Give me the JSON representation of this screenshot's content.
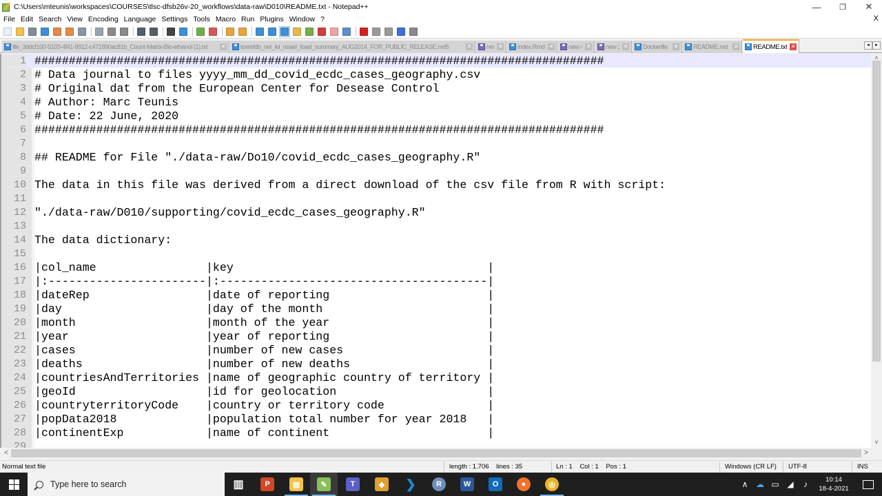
{
  "window": {
    "title": "C:\\Users\\mteunis\\workspaces\\COURSES\\tlsc-dfsb26v-20_workflows\\data-raw\\D010\\README.txt - Notepad++",
    "minimize": "—",
    "restore": "❐",
    "close": "✕"
  },
  "menu": {
    "items": [
      "File",
      "Edit",
      "Search",
      "View",
      "Encoding",
      "Language",
      "Settings",
      "Tools",
      "Macro",
      "Run",
      "Plugins",
      "Window",
      "?"
    ],
    "close_doc": "X"
  },
  "toolbar": {
    "buttons": [
      {
        "name": "new-file",
        "color": "#e9f0f8"
      },
      {
        "name": "open-file",
        "color": "#f3c24b"
      },
      {
        "name": "save",
        "color": "#7f8d9c"
      },
      {
        "name": "save-all",
        "color": "#3d8fd8"
      },
      {
        "name": "close",
        "color": "#e38a4a"
      },
      {
        "name": "close-all",
        "color": "#e38a4a"
      },
      {
        "name": "print",
        "color": "#8a96a6"
      },
      {
        "name": "sep"
      },
      {
        "name": "cut",
        "color": "#9aa3ad"
      },
      {
        "name": "copy",
        "color": "#8a8a8a"
      },
      {
        "name": "paste",
        "color": "#8a8a8a"
      },
      {
        "name": "sep"
      },
      {
        "name": "undo",
        "color": "#555f6b"
      },
      {
        "name": "redo",
        "color": "#555f6b"
      },
      {
        "name": "sep"
      },
      {
        "name": "find",
        "color": "#444"
      },
      {
        "name": "replace",
        "color": "#3d8fd8"
      },
      {
        "name": "sep"
      },
      {
        "name": "zoom-in",
        "color": "#6bb04a"
      },
      {
        "name": "zoom-out",
        "color": "#d45a5a"
      },
      {
        "name": "sep"
      },
      {
        "name": "sync-vertical",
        "color": "#e8a43a"
      },
      {
        "name": "sync-horizontal",
        "color": "#e8a43a"
      },
      {
        "name": "sep"
      },
      {
        "name": "word-wrap",
        "color": "#3d8fd8"
      },
      {
        "name": "show-all-chars",
        "color": "#3d8fd8"
      },
      {
        "name": "indent-guide",
        "color": "#3d8fd8",
        "active": true
      },
      {
        "name": "udl",
        "color": "#e8b94a"
      },
      {
        "name": "doc-map",
        "color": "#7cab4c"
      },
      {
        "name": "function-list",
        "color": "#d43d3d"
      },
      {
        "name": "folder-workspace",
        "color": "#f0a3a3"
      },
      {
        "name": "doc-monitor",
        "color": "#5a8fc8"
      },
      {
        "name": "sep"
      },
      {
        "name": "record-macro",
        "color": "#d42020"
      },
      {
        "name": "stop-recording",
        "color": "#9a9a9a"
      },
      {
        "name": "playback-macro",
        "color": "#9a9a9a"
      },
      {
        "name": "run-macro-multiple",
        "color": "#3d6fd8"
      },
      {
        "name": "save-macro",
        "color": "#8a8a8a"
      }
    ]
  },
  "tabs": [
    {
      "label": "file_3ddcf100-5103-4f41-9912-c471890ac81b_Count-Matrix-Bio-ethanol (1).txt",
      "icon": "blue",
      "active": false
    },
    {
      "label": "toxrefdb_nel_lel_noael_loael_summary_AUG2014_FOR_PUBLIC_RELEASE.md5",
      "icon": "blue",
      "active": false
    },
    {
      "label": "new 2",
      "icon": "purple",
      "active": false
    },
    {
      "label": "index.Rmd",
      "icon": "blue",
      "active": false
    },
    {
      "label": "new 4",
      "icon": "purple",
      "active": false
    },
    {
      "label": "new 3",
      "icon": "purple",
      "active": false
    },
    {
      "label": "Dockerfile",
      "icon": "blue",
      "active": false
    },
    {
      "label": "README.md",
      "icon": "blue",
      "active": false
    },
    {
      "label": "README.txt",
      "icon": "blue",
      "active": true
    }
  ],
  "tab_scroll": {
    "left": "◂",
    "right": "▸"
  },
  "editor": {
    "current_line": 1,
    "lines": [
      "###################################################################################",
      "# Data journal to files yyyy_mm_dd_covid_ecdc_cases_geography.csv",
      "# Original dat from the European Center for Desease Control",
      "# Author: Marc Teunis",
      "# Date: 22 June, 2020",
      "###################################################################################",
      "",
      "## README for File \"./data-raw/Do10/covid_ecdc_cases_geography.R\"",
      "",
      "The data in this file was derived from a direct download of the csv file from R with script:",
      "",
      "\"./data-raw/D010/supporting/covid_ecdc_cases_geography.R\"",
      "",
      "The data dictionary:",
      "",
      "|col_name                |key                                     |",
      "|:-----------------------|:---------------------------------------|",
      "|dateRep                 |date of reporting                       |",
      "|day                     |day of the month                        |",
      "|month                   |month of the year                       |",
      "|year                    |year of reporting                       |",
      "|cases                   |number of new cases                     |",
      "|deaths                  |number of new deaths                    |",
      "|countriesAndTerritories |name of geographic country of territory |",
      "|geoId                   |id for geolocation                      |",
      "|countryterritoryCode    |country or territory code               |",
      "|popData2018             |population total number for year 2018   |",
      "|continentExp            |name of continent                       |",
      ""
    ],
    "line_numbers": [
      "1",
      "2",
      "3",
      "4",
      "5",
      "6",
      "7",
      "8",
      "9",
      "10",
      "11",
      "12",
      "13",
      "14",
      "15",
      "16",
      "17",
      "18",
      "19",
      "20",
      "21",
      "22",
      "23",
      "24",
      "25",
      "26",
      "27",
      "28",
      "29"
    ]
  },
  "scrollbars": {
    "up": "˄",
    "down": "˅",
    "left": "<",
    "right": ">"
  },
  "statusbar": {
    "file_type": "Normal text file",
    "length_lines": "length : 1.706    lines : 35",
    "position": "Ln : 1    Col : 1    Pos : 1",
    "eol": "Windows (CR LF)",
    "encoding": "UTF-8",
    "mode": "INS"
  },
  "taskbar": {
    "search_placeholder": "Type here to search",
    "apps": [
      {
        "name": "task-view",
        "glyph": "▥",
        "color": "transparent",
        "running": false
      },
      {
        "name": "powerpoint",
        "glyph": "P",
        "color": "#d24726",
        "running": false
      },
      {
        "name": "file-explorer",
        "glyph": "▤",
        "color": "#f3c24b",
        "running": true
      },
      {
        "name": "notepad-plus-plus",
        "glyph": "✎",
        "color": "#8bbf5b",
        "running": true,
        "focused": true
      },
      {
        "name": "teams",
        "glyph": "T",
        "color": "#5b5fc7",
        "running": false
      },
      {
        "name": "git-kraken",
        "glyph": "◆",
        "color": "#e0a030",
        "running": false
      },
      {
        "name": "vscode",
        "glyph": "❯",
        "color": "#1f8ad2",
        "running": false
      },
      {
        "name": "r-gui",
        "glyph": "R",
        "color": "#6f8fb8",
        "running": false
      },
      {
        "name": "word",
        "glyph": "W",
        "color": "#2b579a",
        "running": false
      },
      {
        "name": "outlook",
        "glyph": "O",
        "color": "#0f6cbd",
        "running": false
      },
      {
        "name": "firefox",
        "glyph": "●",
        "color": "#f3722c",
        "running": false
      },
      {
        "name": "chrome-canary",
        "glyph": "◎",
        "color": "#e8b42a",
        "running": true
      }
    ],
    "tray": {
      "chevron": "∧",
      "onedrive": "☁",
      "battery": "▭",
      "wifi": "◢",
      "volume": "♪",
      "time": "10:14",
      "date": "18-4-2021"
    }
  }
}
